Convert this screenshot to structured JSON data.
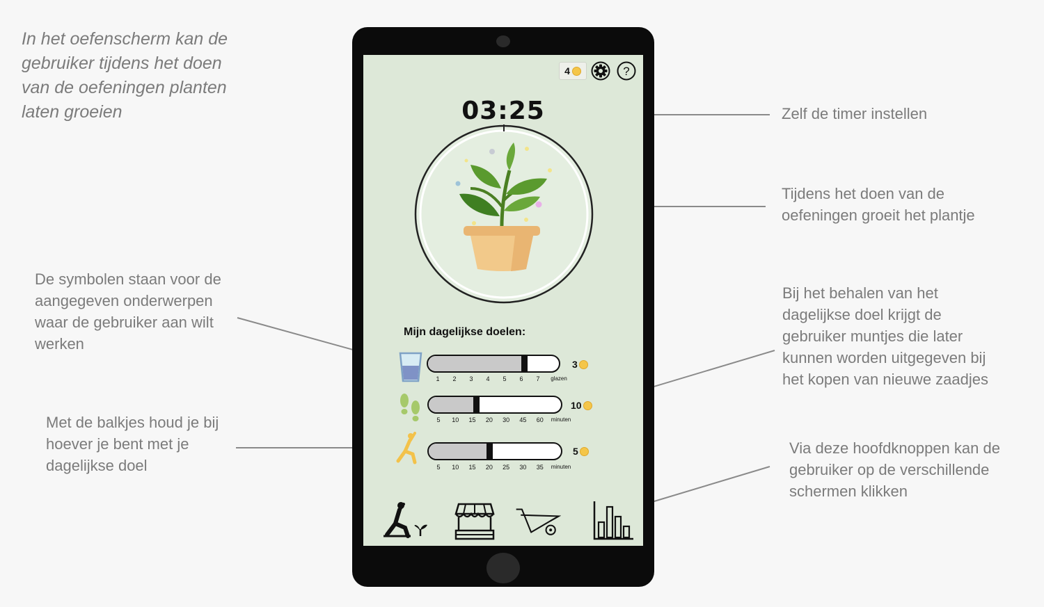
{
  "annotations": {
    "intro": "In het oefenscherm kan de\ngebruiker tijdens het doen\nvan de oefeningen planten\nlaten groeien",
    "timer_note": "Zelf de timer instellen",
    "plant_note": "Tijdens het doen van de\noefeningen groeit het plantje",
    "symbols_note": "De symbolen staan voor de\naangegeven onderwerpen\nwaar de gebruiker aan wilt\nwerken",
    "bars_note": "Met de balkjes houd je bij\nhoever je bent met je\ndagelijkse doel",
    "coins_note": "Bij het behalen van het\ndagelijkse doel krijgt de\ngebruiker muntjes die later\nkunnen worden uitgegeven bij\nhet kopen van nieuwe zaadjes",
    "nav_note": "Via deze hoofdknoppen kan de\ngebruiker op de verschillende\nschermen klikken"
  },
  "app": {
    "coin_count": "4",
    "timer": "03:25",
    "goals_title": "Mijn dagelijkse doelen:",
    "goals": [
      {
        "icon": "water-glass-icon",
        "progress": 0.72,
        "ticks": [
          "1",
          "2",
          "3",
          "4",
          "5",
          "6",
          "7"
        ],
        "unit": "glazen",
        "reward": "3"
      },
      {
        "icon": "footsteps-icon",
        "progress": 0.35,
        "ticks": [
          "5",
          "10",
          "15",
          "20",
          "30",
          "45",
          "60"
        ],
        "unit": "minuten",
        "reward": "10"
      },
      {
        "icon": "yoga-pose-icon",
        "progress": 0.45,
        "ticks": [
          "5",
          "10",
          "15",
          "20",
          "25",
          "30",
          "35"
        ],
        "unit": "minuten",
        "reward": "5"
      }
    ],
    "nav": [
      "exercise-plant-icon",
      "shop-stall-icon",
      "wheelbarrow-icon",
      "bar-chart-icon"
    ],
    "colors": {
      "screen_bg": "#dde8d8",
      "leaf": "#5a9a2e",
      "pot": "#f2c98a",
      "coin": "#f4c64a",
      "accent_yellow": "#f3c24a",
      "accent_green": "#a6c96a"
    }
  }
}
